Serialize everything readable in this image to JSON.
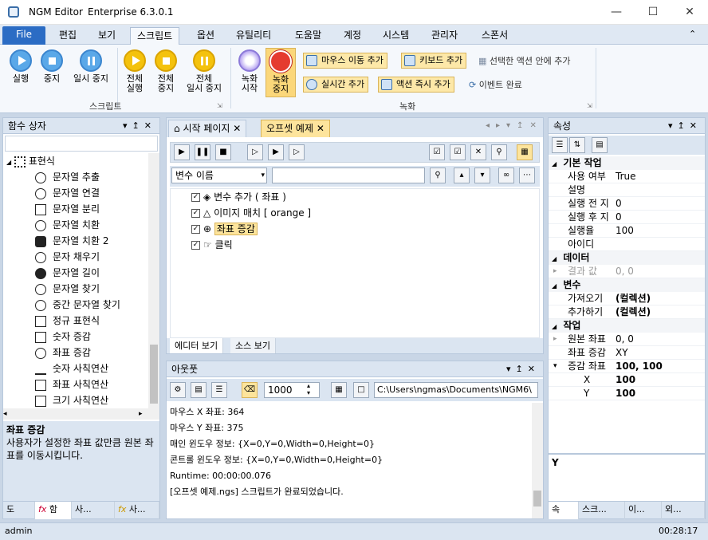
{
  "window": {
    "app": "NGM Editor",
    "edition": "Enterprise 6.3.0.1"
  },
  "menu": [
    "File",
    "편집",
    "보기",
    "스크립트",
    "옵션",
    "유틸리티",
    "도움말",
    "계정",
    "시스템",
    "관리자",
    "스폰서"
  ],
  "ribbon": {
    "script_group": "스크립트",
    "record_group": "녹화",
    "run": "실행",
    "stop": "중지",
    "pause": "일시 중지",
    "run_all": [
      "전체",
      "실행"
    ],
    "stop_all": [
      "전체",
      "중지"
    ],
    "pause_all": [
      "전체",
      "일시 중지"
    ],
    "record_start": [
      "녹화",
      "시작"
    ],
    "record_stop": [
      "녹화",
      "중지"
    ],
    "mouse_move": "마우스 이동 추가",
    "keyboard": "키보드 추가",
    "add_in_selected": "선택한 액션 안에 추가",
    "realtime": "실시간 추가",
    "action_now": "액션 즉시 추가",
    "event_done": "이벤트 완료"
  },
  "left": {
    "title": "함수 상자",
    "category": "표현식",
    "items": [
      "문자열 추출",
      "문자열 연결",
      "문자열 분리",
      "문자열 치환",
      "문자열 치환 2",
      "문자 채우기",
      "문자열 길이",
      "문자열 찾기",
      "중간 문자열 찾기",
      "정규 표현식",
      "숫자 증감",
      "좌표 증감",
      "숫자 사칙연산",
      "좌표 사칙연산",
      "크기 사칙연산"
    ],
    "desc_title": "좌표 증감",
    "desc_text": "사용자가 설정한 좌표 값만큼 원본 좌표를 이동시킵니다.",
    "tabs": [
      "도",
      "함",
      "사...",
      "사..."
    ]
  },
  "center": {
    "tabs": [
      "시작 페이지",
      "오프셋 예제"
    ],
    "var_select": "변수 이름",
    "lines": [
      "변수 추가 ( 좌표 )",
      "이미지 매치 [ orange ]",
      "좌표 증감",
      "클릭"
    ],
    "bottom_tabs": [
      "에디터 보기",
      "소스 보기"
    ]
  },
  "output": {
    "title": "아웃풋",
    "interval": "1000",
    "path": "C:\\Users\\ngmas\\Documents\\NGM6\\",
    "lines": [
      "마우스 X 좌표: 364",
      "마우스 Y 좌표: 375",
      "매인 윈도우 정보: {X=0,Y=0,Width=0,Height=0}",
      "콘트롤 윈도우 정보: {X=0,Y=0,Width=0,Height=0}",
      "Runtime: 00:00:00.076",
      "[오프셋 예제.ngs] 스크립트가 완료되었습니다."
    ]
  },
  "props": {
    "title": "속성",
    "cat_basic": "기본 작업",
    "basic": [
      [
        "사용 여부",
        "True"
      ],
      [
        "설명",
        ""
      ],
      [
        "실행 전 지",
        "0"
      ],
      [
        "실행 후 지",
        "0"
      ],
      [
        "실행율",
        "100"
      ],
      [
        "아이디",
        ""
      ]
    ],
    "cat_data": "데이터",
    "data": [
      [
        "결과 값",
        "0, 0"
      ]
    ],
    "cat_var": "변수",
    "var": [
      [
        "가져오기",
        "(컬렉션)"
      ],
      [
        "추가하기",
        "(컬렉션)"
      ]
    ],
    "cat_work": "작업",
    "work": [
      [
        "원본 좌표",
        "0, 0"
      ],
      [
        "좌표 증감",
        "XY"
      ],
      [
        "증감 좌표",
        "100, 100"
      ],
      [
        "X",
        "100"
      ],
      [
        "Y",
        "100"
      ]
    ],
    "desc": "Y",
    "tabs": [
      "속",
      "스크...",
      "이...",
      "외..."
    ]
  },
  "status": {
    "user": "admin",
    "time": "00:28:17"
  }
}
